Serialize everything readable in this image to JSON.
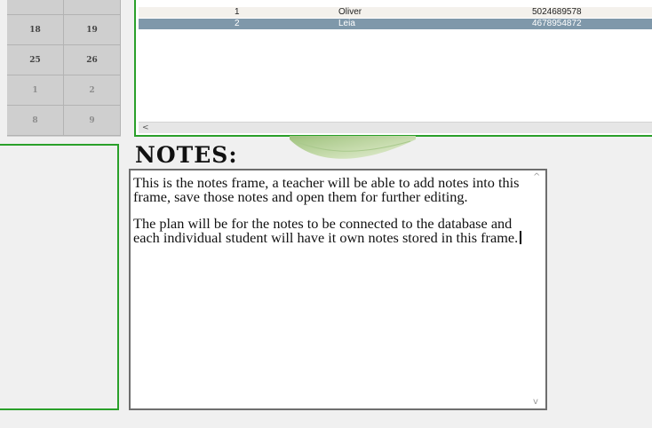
{
  "calendar": {
    "rows": [
      {
        "cells": [
          "",
          ""
        ],
        "dim": false
      },
      {
        "cells": [
          "18",
          "19"
        ],
        "dim": false
      },
      {
        "cells": [
          "25",
          "26"
        ],
        "dim": false
      },
      {
        "cells": [
          "1",
          "2"
        ],
        "dim": true
      },
      {
        "cells": [
          "8",
          "9"
        ],
        "dim": true
      }
    ]
  },
  "students_table": {
    "rows": [
      {
        "num": "1",
        "name": "Oliver",
        "phone": "5024689578",
        "selected": false
      },
      {
        "num": "2",
        "name": "Leia",
        "phone": "4678954872",
        "selected": true
      }
    ],
    "scroll_left": "<"
  },
  "notes": {
    "title": "NOTES:",
    "paragraph1": "This is the notes frame, a teacher will be able to add notes into this frame, save those notes and open them for further editing.",
    "paragraph2": "The plan will be for the notes to be connected to the database and each individual student will have it own notes stored in this frame.",
    "scroll_up": "^",
    "scroll_down": "v"
  },
  "colors": {
    "frame_border": "#2aa02a",
    "selected_row": "#7f98aa",
    "calendar_bg": "#cfcfcf"
  }
}
